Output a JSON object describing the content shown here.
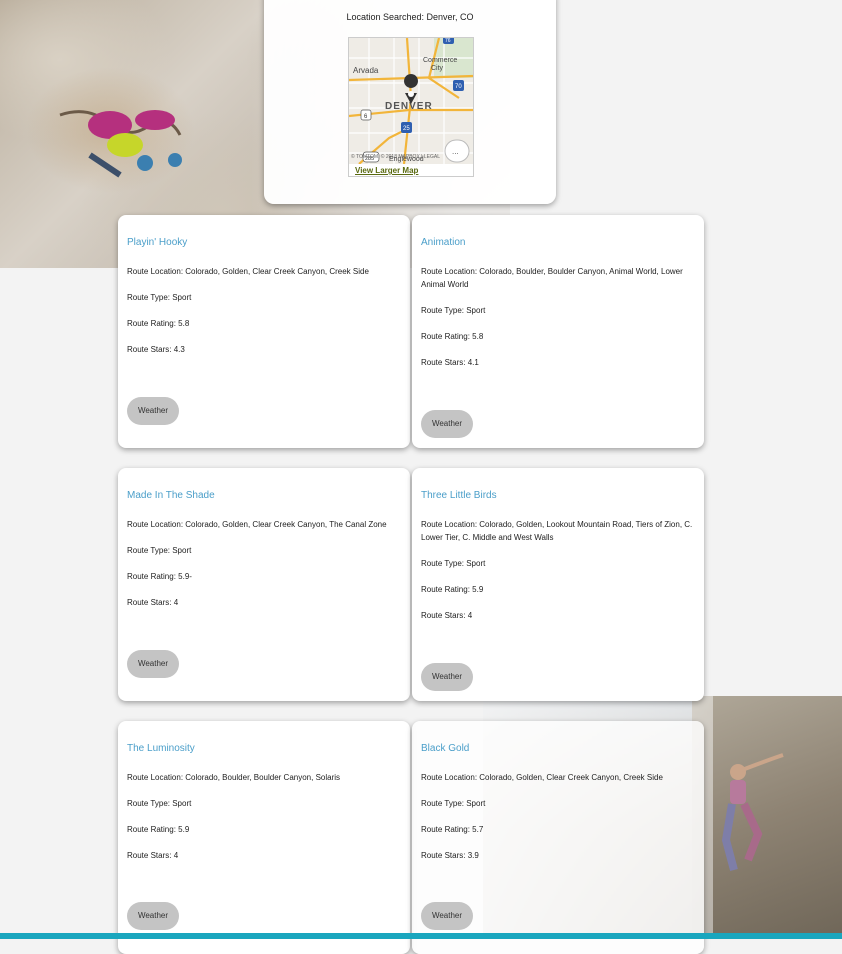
{
  "location": {
    "label": "Location Searched: Denver, CO",
    "map_link": "View Larger Map",
    "map_labels": {
      "arvada": "Arvada",
      "commerce": "Commerce",
      "city": "City",
      "denver": "DENVER",
      "englewood": "Englewood",
      "attribution": "© TOMTOM, © 2018 MAPBOX",
      "legal": "LEGAL",
      "hwy6": "6",
      "hwy25": "25",
      "hwy70": "70",
      "hwy285": "285",
      "hwy76": "76",
      "more": "..."
    }
  },
  "weather_label": "Weather",
  "routes": [
    {
      "name": "Playin' Hooky",
      "location": "Route Location: Colorado, Golden, Clear Creek Canyon, Creek Side",
      "type": "Route Type: Sport",
      "rating": "Route Rating: 5.8",
      "stars": "Route Stars: 4.3"
    },
    {
      "name": "Animation",
      "location": "Route Location: Colorado, Boulder, Boulder Canyon, Animal World, Lower Animal World",
      "type": "Route Type: Sport",
      "rating": "Route Rating: 5.8",
      "stars": "Route Stars: 4.1"
    },
    {
      "name": "Made In The Shade",
      "location": "Route Location: Colorado, Golden, Clear Creek Canyon, The Canal Zone",
      "type": "Route Type: Sport",
      "rating": "Route Rating: 5.9-",
      "stars": "Route Stars: 4"
    },
    {
      "name": "Three Little Birds",
      "location": "Route Location: Colorado, Golden, Lookout Mountain Road, Tiers of Zion, C. Lower Tier, C. Middle and West Walls",
      "type": "Route Type: Sport",
      "rating": "Route Rating: 5.9",
      "stars": "Route Stars: 4"
    },
    {
      "name": "The Luminosity",
      "location": "Route Location: Colorado, Boulder, Boulder Canyon, Solaris",
      "type": "Route Type: Sport",
      "rating": "Route Rating: 5.9",
      "stars": "Route Stars: 4"
    },
    {
      "name": "Black Gold",
      "location": "Route Location: Colorado, Golden, Clear Creek Canyon, Creek Side",
      "type": "Route Type: Sport",
      "rating": "Route Rating: 5.7",
      "stars": "Route Stars: 3.9"
    }
  ],
  "colors": {
    "route_name": "#4a9ec9",
    "weather_button": "#c4c4c4",
    "accent_bar": "#1aa6be",
    "map_link": "#5a6a10"
  }
}
